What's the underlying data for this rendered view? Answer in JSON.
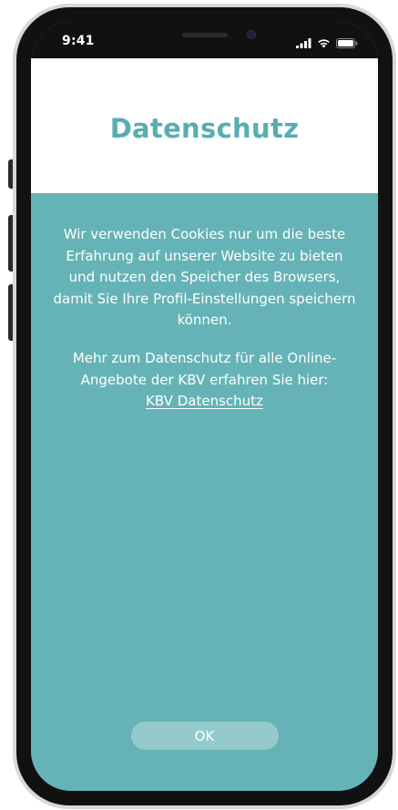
{
  "status_bar": {
    "time": "9:41"
  },
  "icons": {
    "signal": "signal-icon",
    "wifi": "wifi-icon",
    "battery": "battery-icon"
  },
  "dialog": {
    "title": "Datenschutz",
    "paragraph_1": "Wir verwenden Cookies nur um die beste Erfahrung auf unserer Website zu bieten und nutzen den Speicher des Browsers, damit Sie Ihre Profil-Einstellungen speichern können.",
    "paragraph_2": "Mehr zum Datenschutz für alle Online-Angebote der KBV erfahren Sie hier:",
    "link_label": "KBV Datenschutz",
    "ok_label": "OK"
  },
  "colors": {
    "accent_teal": "#65b3b6",
    "title_teal": "#58adb0",
    "button_light_teal": "#94cacb"
  }
}
